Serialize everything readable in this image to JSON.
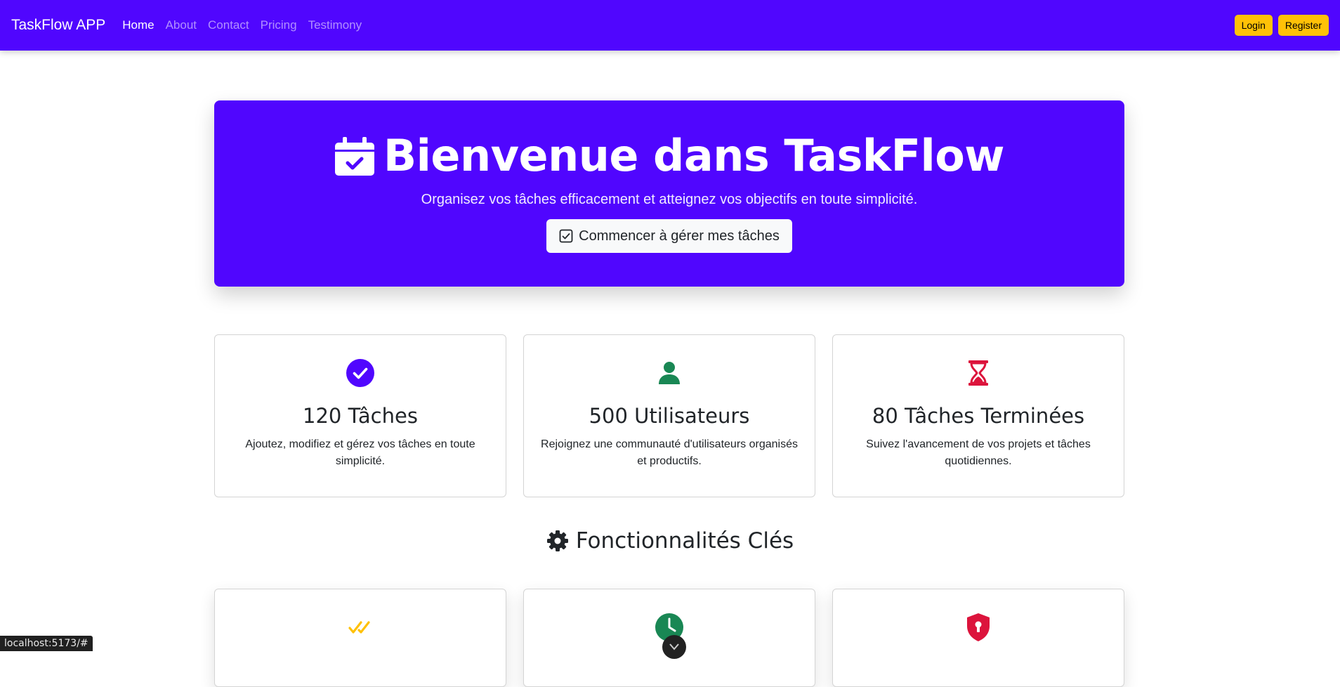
{
  "navbar": {
    "brand": "TaskFlow APP",
    "links": [
      {
        "label": "Home",
        "active": true
      },
      {
        "label": "About",
        "active": false
      },
      {
        "label": "Contact",
        "active": false
      },
      {
        "label": "Pricing",
        "active": false
      },
      {
        "label": "Testimony",
        "active": false
      }
    ],
    "login_label": "Login",
    "register_label": "Register"
  },
  "hero": {
    "icon": "calendar-check-icon",
    "title": "Bienvenue dans TaskFlow",
    "subtitle": "Organisez vos tâches efficacement et atteignez vos objectifs en toute simplicité.",
    "cta_icon": "check-square-icon",
    "cta_label": "Commencer à gérer mes tâches"
  },
  "stats": [
    {
      "icon": "check-circle-icon",
      "title": "120 Tâches",
      "text": "Ajoutez, modifiez et gérez vos tâches en toute simplicité."
    },
    {
      "icon": "user-icon",
      "title": "500 Utilisateurs",
      "text": "Rejoignez une communauté d'utilisateurs organisés et productifs."
    },
    {
      "icon": "hourglass-icon",
      "title": "80 Tâches Terminées",
      "text": "Suivez l'avancement de vos projets et tâches quotidiennes."
    }
  ],
  "features_section": {
    "icon": "gear-icon",
    "title": "Fonctionnalités Clés"
  },
  "features": [
    {
      "icon": "double-check-icon"
    },
    {
      "icon": "clock-icon"
    },
    {
      "icon": "shield-lock-icon"
    }
  ],
  "status_bar": {
    "url": "localhost:5173/#"
  },
  "colors": {
    "primary": "#5006fe",
    "warning": "#ffc107",
    "success": "#198754",
    "danger": "#dc143c"
  }
}
